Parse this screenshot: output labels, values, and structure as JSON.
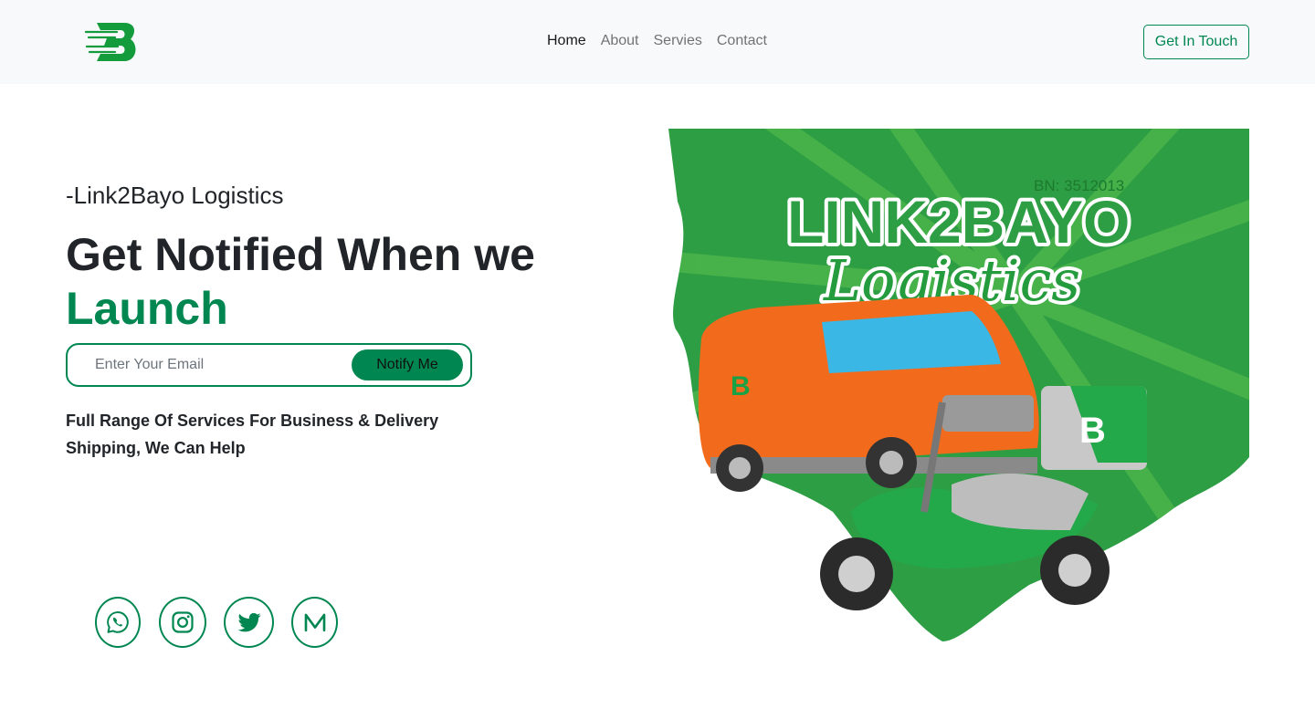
{
  "nav": {
    "logo_icon": "link2bayo-b-logo-icon",
    "links": [
      {
        "label": "Home",
        "active": true
      },
      {
        "label": "About",
        "active": false
      },
      {
        "label": "Servies",
        "active": false
      },
      {
        "label": "Contact",
        "active": false
      }
    ],
    "cta_label": "Get In Touch"
  },
  "hero": {
    "tagline": "-Link2Bayo Logistics",
    "headline": "Get Notified When we",
    "headline_accent": "Launch",
    "email_placeholder": "Enter Your Email",
    "notify_label": "Notify Me",
    "description": "Full Range Of Services For Business & Delivery Shipping, We Can Help"
  },
  "socials": [
    {
      "icon": "whatsapp-icon"
    },
    {
      "icon": "instagram-icon"
    },
    {
      "icon": "twitter-icon"
    },
    {
      "icon": "medium-icon"
    }
  ],
  "illustration": {
    "brand_line1": "LINK2BAYO",
    "brand_line2": "Logistics",
    "registration": "BN: 3512013"
  },
  "colors": {
    "brand_green": "#008751",
    "navbar_bg": "#f8f9fa",
    "text_dark": "#212529",
    "art_green": "#2e9e44",
    "van_orange": "#f26b1d"
  }
}
